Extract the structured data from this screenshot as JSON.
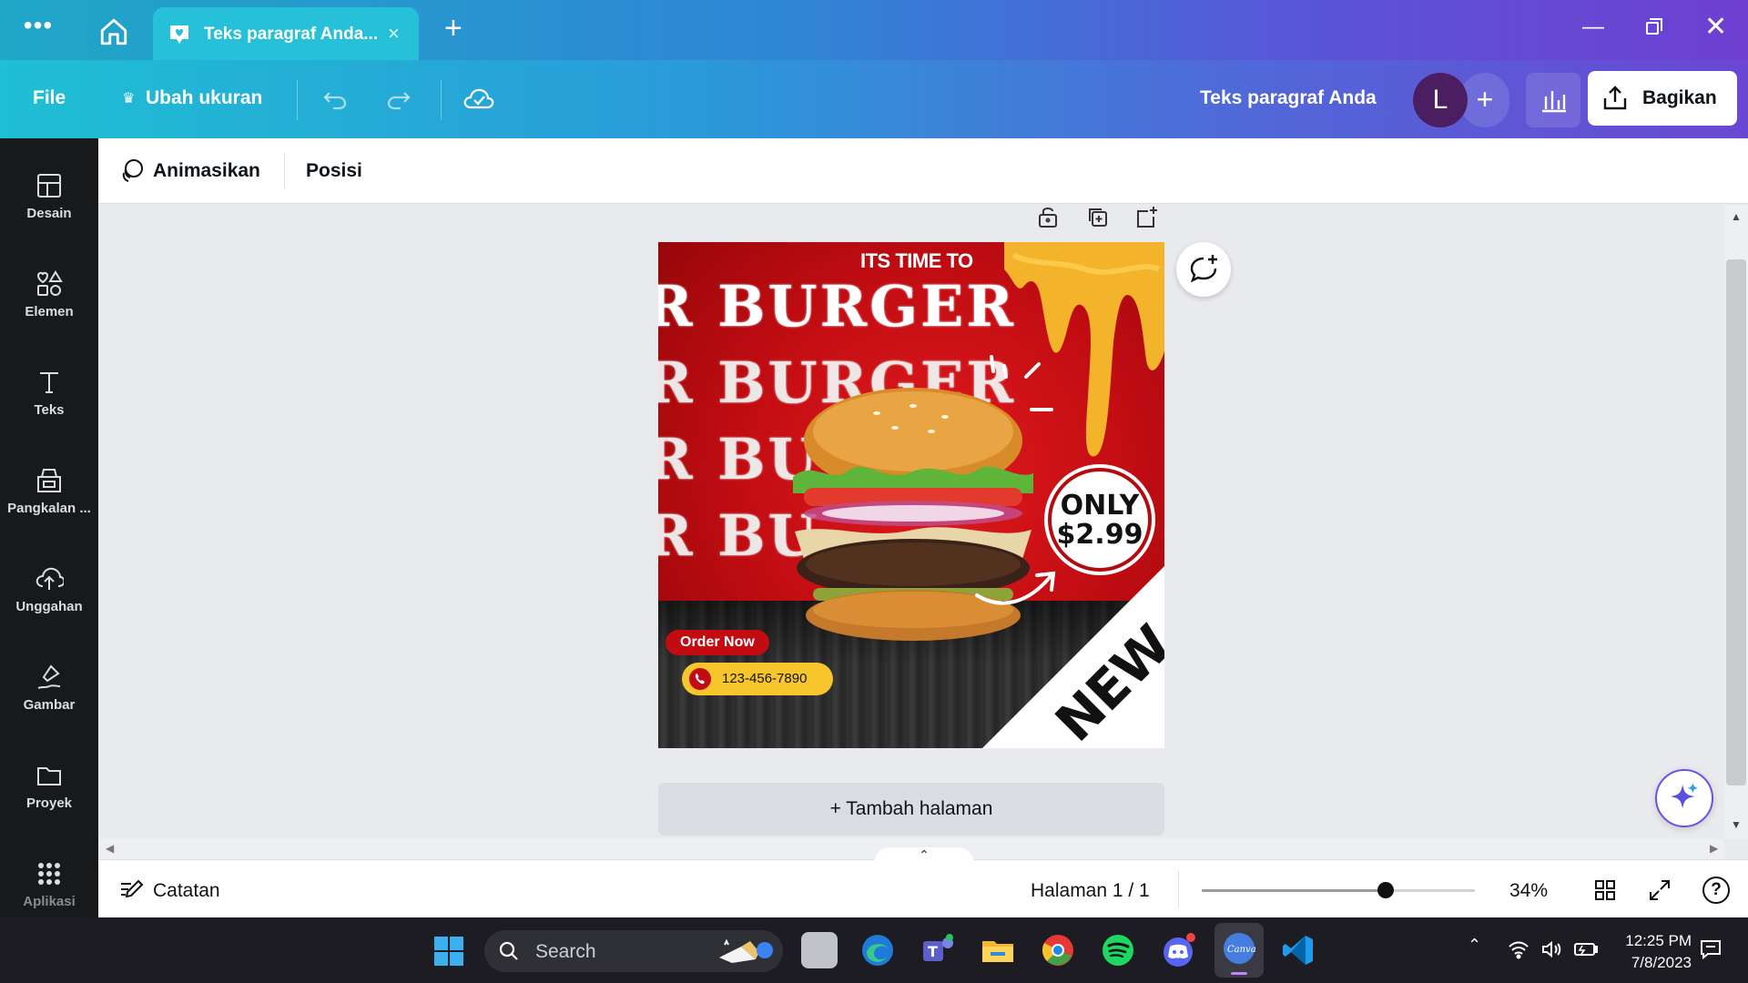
{
  "browser": {
    "tab_title": "Teks paragraf Anda...",
    "tab_close": "×",
    "new_tab": "+",
    "menu_dots": "•••",
    "window_min": "—",
    "window_close": "✕"
  },
  "header": {
    "file": "File",
    "resize": "Ubah ukuran",
    "doc_title": "Teks paragraf Anda",
    "avatar_initial": "L",
    "add": "+",
    "share": "Bagikan"
  },
  "sidebar": {
    "items": [
      {
        "label": "Desain",
        "icon": "layout-icon"
      },
      {
        "label": "Elemen",
        "icon": "shapes-icon"
      },
      {
        "label": "Teks",
        "icon": "text-icon"
      },
      {
        "label": "Pangkalan ...",
        "icon": "brand-kit-icon"
      },
      {
        "label": "Unggahan",
        "icon": "upload-icon"
      },
      {
        "label": "Gambar",
        "icon": "draw-icon"
      },
      {
        "label": "Proyek",
        "icon": "folder-icon"
      },
      {
        "label": "Aplikasi",
        "icon": "apps-icon"
      }
    ]
  },
  "toolbar": {
    "animate": "Animasikan",
    "position": "Posisi"
  },
  "design": {
    "headline": "ITS TIME TO",
    "bg_words": [
      "R BURGER",
      "R BURGER",
      "R BU",
      "R BU"
    ],
    "price_only": "ONLY",
    "price_value": "$2.99",
    "badge_new": "NEW",
    "order_button": "Order Now",
    "phone": "123-456-7890",
    "colors": {
      "primary": "#c10d12",
      "accent": "#f7c62c",
      "wood": "#2b2b2b"
    }
  },
  "canvas": {
    "add_page": "+ Tambah halaman"
  },
  "footer": {
    "notes": "Catatan",
    "page": "Halaman 1 / 1",
    "zoom": "34%",
    "zoom_fraction": 0.34,
    "help": "?",
    "expand": "⌃"
  },
  "taskbar": {
    "search": "Search",
    "time": "12:25 PM",
    "date": "7/8/2023"
  }
}
